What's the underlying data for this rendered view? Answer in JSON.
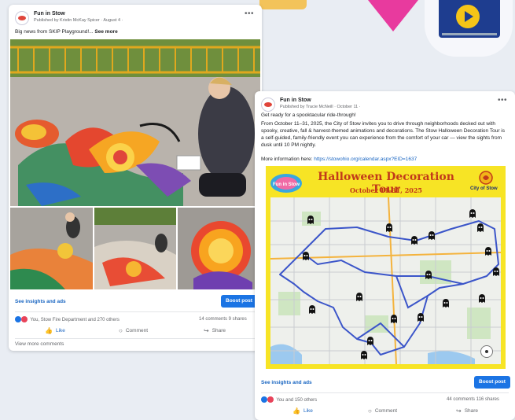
{
  "post1": {
    "page_name": "Fun in Stow",
    "meta": "Published by Kristin McKay Spicer · August 4 ·",
    "text": "Big news from SKIP Playground!...",
    "see_more": "See more",
    "insights": "See insights and ads",
    "boost": "Boost post",
    "reactions": "You, Stow Fire Department and 270 others",
    "counts": "14 comments  9 shares",
    "like": "Like",
    "comment": "Comment",
    "share": "Share",
    "view_more": "View more comments"
  },
  "post2": {
    "page_name": "Fun in Stow",
    "meta": "Published by Tracie McNeill · October 11 ·",
    "intro": "Get ready for a spooktacular ride-through!",
    "body": "From October 11–31, 2025, the City of Stow invites you to drive through neighborhoods decked out with spooky, creative, fall & harvest-themed animations and decorations. The Stow Halloween Decoration Tour is a self-guided, family-friendly event you can experience from the comfort of your car — view the sights from dusk until 10 PM nightly.",
    "more_info_label": "More information here:",
    "more_info_link": "https://stowohio.org/calendar.aspx?EID=1637",
    "insights": "See insights and ads",
    "boost": "Boost post",
    "reactions": "You and 150 others",
    "counts": "44 comments  116 shares",
    "like": "Like",
    "comment": "Comment",
    "share": "Share",
    "flyer": {
      "title": "Halloween Decoration Tour",
      "date": "October 11-31, 2025",
      "logo_left": "Fun in Stow",
      "logo_right": "City of Stow"
    }
  },
  "colors": {
    "facebook_blue": "#1b74e4",
    "flyer_yellow": "#f7e425",
    "route_blue": "#3b55c9",
    "flyer_title_red": "#c23a1a"
  },
  "icons": [
    "play-icon",
    "like-icon",
    "comment-icon",
    "share-icon",
    "more-options-icon",
    "ghost-marker-icon",
    "compass-icon"
  ]
}
